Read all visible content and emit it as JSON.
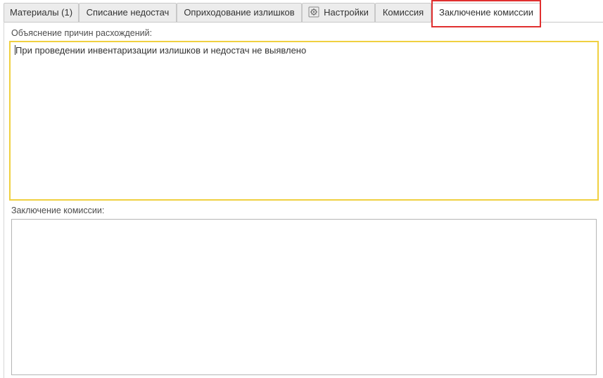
{
  "tabs": [
    {
      "label": "Материалы (1)",
      "active": false,
      "icon": null
    },
    {
      "label": "Списание недостач",
      "active": false,
      "icon": null
    },
    {
      "label": "Оприходование излишков",
      "active": false,
      "icon": null
    },
    {
      "label": "Настройки",
      "active": false,
      "icon": "gear-icon"
    },
    {
      "label": "Комиссия",
      "active": false,
      "icon": null
    },
    {
      "label": "Заключение комиссии",
      "active": true,
      "icon": null
    }
  ],
  "discrepancy": {
    "label": "Объяснение причин расхождений:",
    "value": "При проведении инвентаризации излишков и недостач не выявлено"
  },
  "conclusion": {
    "label": "Заключение комиссии:",
    "value": ""
  },
  "colors": {
    "highlight": "#e03030",
    "focus_border": "#f0d040",
    "tab_background": "#ececec"
  }
}
